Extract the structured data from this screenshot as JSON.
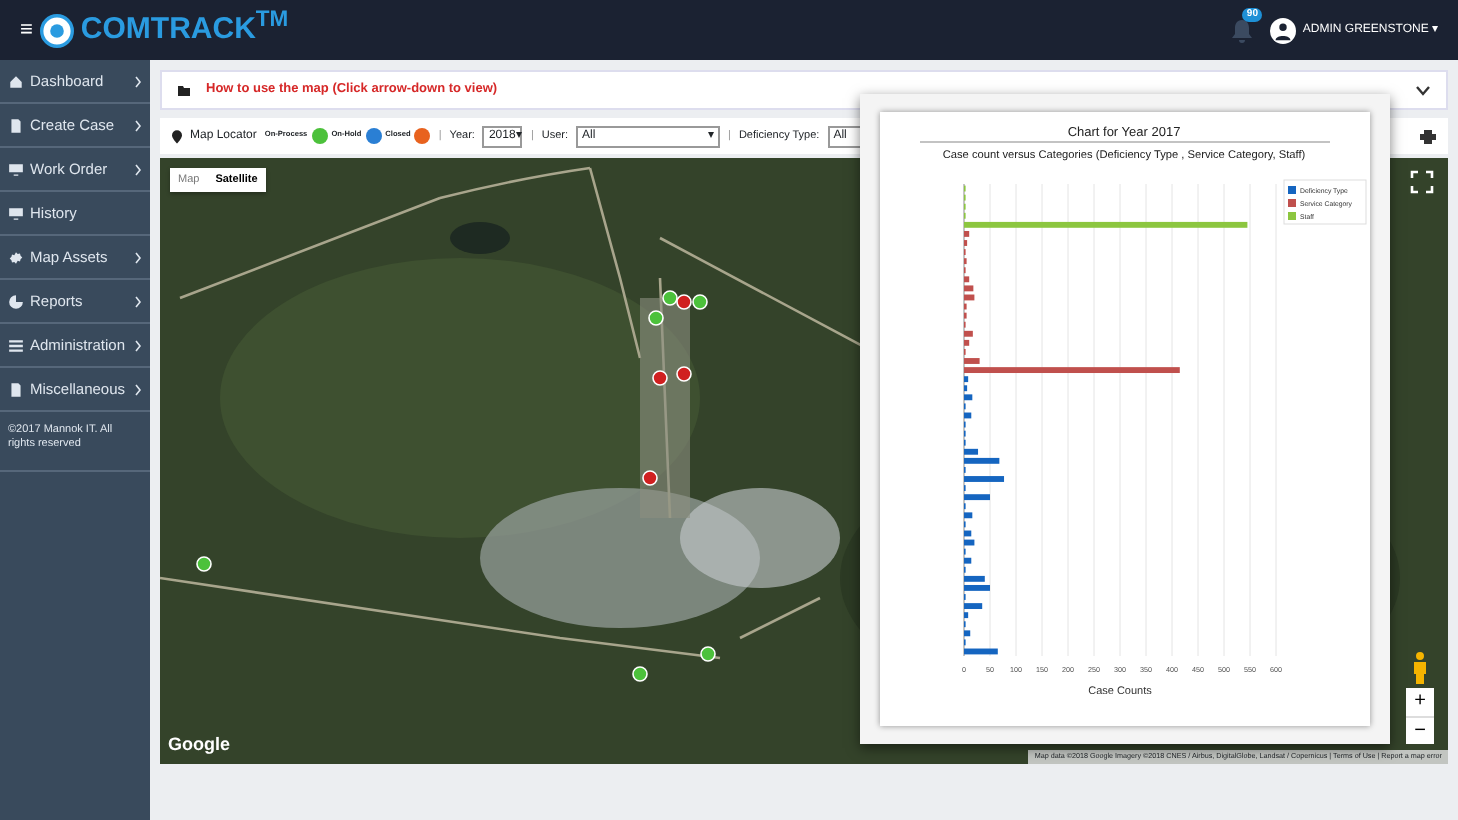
{
  "header": {
    "menu_icon": "≡",
    "brand": "COMTRACK$^{TM}$",
    "notification_count": "90",
    "user": "ADMIN GREENSTONE",
    "user_caret": "▾"
  },
  "sidebar": {
    "items": [
      {
        "label": "Dashboard",
        "chevron": true
      },
      {
        "label": "Create Case",
        "chevron": true
      },
      {
        "label": "Work Order",
        "chevron": true
      },
      {
        "label": "History",
        "chevron": false
      },
      {
        "label": "Map Assets",
        "chevron": true
      },
      {
        "label": "Reports",
        "chevron": true
      },
      {
        "label": "Administration",
        "chevron": true
      },
      {
        "label": "Miscellaneous",
        "chevron": true
      }
    ],
    "footer": "©2017 Mannok IT. All rights reserved"
  },
  "help_bar": {
    "text": "How to use the map (Click arrow-down to view)"
  },
  "toolbar": {
    "title": "Map Locator",
    "legend": [
      {
        "label": "On-Process",
        "color": "#4cc13b"
      },
      {
        "label": "On-Hold",
        "color": "#2a7fd4"
      },
      {
        "label": "Closed",
        "color": "#e8621e"
      }
    ],
    "filters": [
      {
        "separator": "|",
        "label": "Year:",
        "value": "2018",
        "arrow": "▾",
        "kind": "small"
      },
      {
        "separator": "|",
        "label": "User:",
        "value": "All",
        "arrow": "▾",
        "kind": "wide"
      },
      {
        "separator": "|",
        "label": "Deficiency Type:",
        "value": "All",
        "kind": "wide"
      }
    ]
  },
  "map": {
    "type_buttons": [
      {
        "label": "Map",
        "selected": false
      },
      {
        "label": "Satellite",
        "selected": true
      }
    ],
    "zoom_in": "+",
    "zoom_out": "−",
    "logo": "Google",
    "attribution": "Map data ©2018 Google Imagery ©2018 CNES / Airbus, DigitalGlobe, Landsat / Copernicus | Terms of Use | Report a map error"
  },
  "chart_popup": {
    "chart_data": {
      "type": "bar",
      "orientation": "horizontal",
      "grid": true,
      "legend": true,
      "title": "Chart for Year 2017",
      "subtitle": "Case count versus Categories (Deficiency Type , Service Category, Staff)",
      "xlabel": "Case Counts",
      "xlim": [
        0,
        600
      ],
      "xticks": [
        0,
        50,
        100,
        150,
        200,
        250,
        300,
        350,
        400,
        450,
        500,
        550,
        600
      ],
      "series": [
        {
          "name": "Deficiency Type",
          "color": "#1565c0",
          "values": [
            null,
            null,
            null,
            null,
            null,
            null,
            null,
            null,
            null,
            null,
            null,
            null,
            null,
            null,
            null,
            null,
            null,
            null,
            null,
            null,
            null,
            8,
            6,
            16,
            2,
            14,
            2,
            2,
            2,
            27,
            68,
            2,
            77,
            2,
            50,
            2,
            16,
            2,
            14,
            20,
            2,
            14,
            2,
            40,
            50,
            2,
            35,
            8,
            2,
            12,
            2,
            65
          ]
        },
        {
          "name": "Service Category",
          "color": "#c0504d",
          "values": [
            null,
            null,
            null,
            null,
            null,
            10,
            6,
            2,
            5,
            2,
            10,
            18,
            20,
            5,
            5,
            2,
            17,
            10,
            2,
            30,
            415,
            null,
            null,
            null,
            null,
            null,
            null,
            null,
            null,
            null,
            null,
            null,
            null,
            null,
            null,
            null,
            null,
            null,
            null,
            null,
            null,
            null,
            null,
            null,
            null,
            null,
            null,
            null,
            null,
            null,
            null,
            null
          ]
        },
        {
          "name": "Staff",
          "color": "#8cc63f",
          "values": [
            2,
            2,
            2,
            2,
            545,
            null,
            null,
            null,
            null,
            null,
            null,
            null,
            null,
            null,
            null,
            null,
            null,
            null,
            null,
            null,
            null,
            null,
            null,
            null,
            null,
            null,
            null,
            null,
            null,
            null,
            null,
            null,
            null,
            null,
            null,
            null,
            null,
            null,
            null,
            null,
            null,
            null,
            null,
            null,
            null,
            null,
            null,
            null,
            null,
            null,
            null,
            null
          ]
        }
      ]
    }
  }
}
